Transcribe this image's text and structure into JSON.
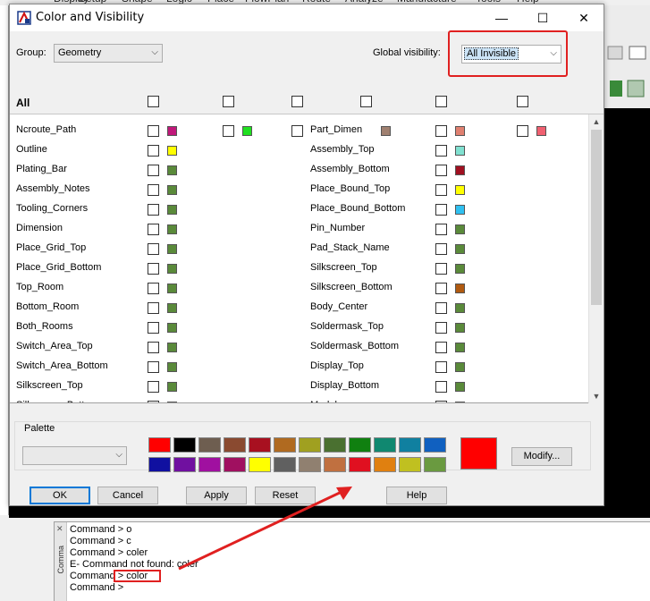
{
  "window": {
    "title": "Color and Visibility"
  },
  "titlebar": {
    "minimize": "—",
    "maximize": "☐",
    "close": "✕"
  },
  "group": {
    "label": "Group:",
    "value": "Geometry"
  },
  "global_visibility": {
    "label": "Global visibility:",
    "value": "All Invisible"
  },
  "all_label": "All",
  "rows_left": [
    {
      "name": "Ncroute_Path",
      "color": "#c0187a"
    },
    {
      "name": "Outline",
      "color": "#ffff00"
    },
    {
      "name": "Plating_Bar",
      "color": "#5a8a3a"
    },
    {
      "name": "Assembly_Notes",
      "color": "#5a8a3a"
    },
    {
      "name": "Tooling_Corners",
      "color": "#5a8a3a"
    },
    {
      "name": "Dimension",
      "color": "#5a8a3a"
    },
    {
      "name": "Place_Grid_Top",
      "color": "#5a8a3a"
    },
    {
      "name": "Place_Grid_Bottom",
      "color": "#5a8a3a"
    },
    {
      "name": "Top_Room",
      "color": "#5a8a3a"
    },
    {
      "name": "Bottom_Room",
      "color": "#5a8a3a"
    },
    {
      "name": "Both_Rooms",
      "color": "#5a8a3a"
    },
    {
      "name": "Switch_Area_Top",
      "color": "#5a8a3a"
    },
    {
      "name": "Switch_Area_Bottom",
      "color": "#5a8a3a"
    },
    {
      "name": "Silkscreen_Top",
      "color": "#5a8a3a"
    },
    {
      "name": "Silkscreen_Bottom",
      "color": "#5a8a3a"
    }
  ],
  "rows_right": [
    {
      "name": "Part_Dimen",
      "color": "#e08070"
    },
    {
      "name": "Assembly_Top",
      "color": "#80e0d0"
    },
    {
      "name": "Assembly_Bottom",
      "color": "#a01020"
    },
    {
      "name": "Place_Bound_Top",
      "color": "#ffff00"
    },
    {
      "name": "Place_Bound_Bottom",
      "color": "#30c0f0"
    },
    {
      "name": "Pin_Number",
      "color": "#5a8a3a"
    },
    {
      "name": "Pad_Stack_Name",
      "color": "#5a8a3a"
    },
    {
      "name": "Silkscreen_Top",
      "color": "#5a8a3a"
    },
    {
      "name": "Silkscreen_Bottom",
      "color": "#b05a10"
    },
    {
      "name": "Body_Center",
      "color": "#5a8a3a"
    },
    {
      "name": "Soldermask_Top",
      "color": "#5a8a3a"
    },
    {
      "name": "Soldermask_Bottom",
      "color": "#5a8a3a"
    },
    {
      "name": "Display_Top",
      "color": "#5a8a3a"
    },
    {
      "name": "Display_Bottom",
      "color": "#5a8a3a"
    },
    {
      "name": "Modules",
      "color": "#5a8a3a"
    }
  ],
  "first_row_extra_colors": [
    "#20e020",
    "#a08070",
    "#f06070"
  ],
  "palette": {
    "label": "Palette",
    "row1": [
      "#ff0000",
      "#000000",
      "#6e5e50",
      "#8a4a30",
      "#a81020",
      "#b06a20",
      "#a0a020",
      "#4a7030",
      "#108010",
      "#108870",
      "#1080a0",
      "#1060c0"
    ],
    "row2": [
      "#1010a0",
      "#7010a0",
      "#a010a0",
      "#a01060",
      "#ffff00",
      "#606060",
      "#908070",
      "#c07040",
      "#e01020",
      "#e08010",
      "#c0c020",
      "#6a9a40"
    ],
    "current": "#ff0000",
    "modify_label": "Modify..."
  },
  "buttons": {
    "ok": "OK",
    "cancel": "Cancel",
    "apply": "Apply",
    "reset": "Reset",
    "help": "Help"
  },
  "command": {
    "pane_label": "Comma",
    "lines": [
      "Command > o",
      "Command > c",
      "Command > coler",
      "E- Command not found: coler",
      "Command > color",
      "Command >"
    ]
  },
  "bg_menu": [
    "Display",
    "Setup",
    "Shape",
    "Logic",
    "Place",
    "FlowPlan",
    "Route",
    "Analyze",
    "Manufacture",
    "Tools",
    "Help"
  ],
  "accent": {
    "highlight": "#e02020",
    "focus": "#0078d7"
  }
}
